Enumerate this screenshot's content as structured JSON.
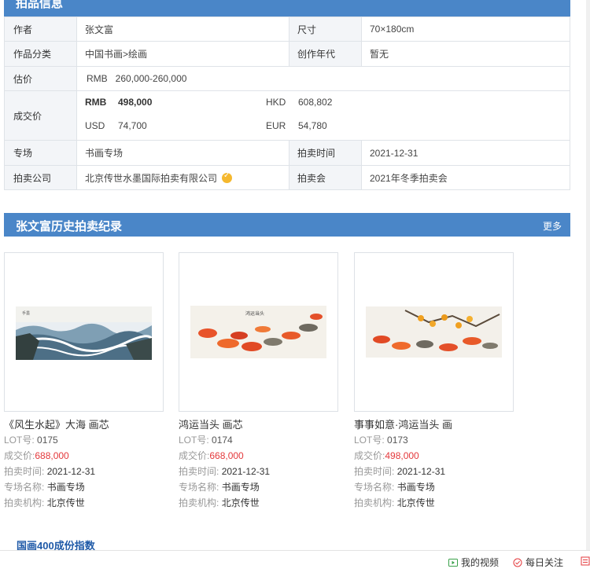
{
  "info_section": {
    "title": "拍品信息"
  },
  "info": {
    "author_label": "作者",
    "author": "张文富",
    "size_label": "尺寸",
    "size": "70×180cm",
    "category_label": "作品分类",
    "category": "中国书画>绘画",
    "era_label": "创作年代",
    "era": "暂无",
    "estimate_label": "估价",
    "estimate": "RMB   260,000-260,000",
    "deal_label": "成交价",
    "deal": {
      "rmb_cur": "RMB",
      "rmb": "498,000",
      "hkd_cur": "HKD",
      "hkd": "608,802",
      "usd_cur": "USD",
      "usd": "74,700",
      "eur_cur": "EUR",
      "eur": "54,780"
    },
    "session_label": "专场",
    "session": "书画专场",
    "time_label": "拍卖时间",
    "time": "2021-12-31",
    "company_label": "拍卖公司",
    "company": "北京传世水墨国际拍卖有限公司",
    "auction_label": "拍卖会",
    "auction": "2021年冬季拍卖会"
  },
  "history_section": {
    "title": "张文富历史拍卖纪录",
    "more": "更多"
  },
  "lots": [
    {
      "name": "《风生水起》大海 画芯",
      "lot_label": "LOT号:",
      "lot": "0175",
      "price_label": "成交价:",
      "price": "688,000",
      "time_label": "拍卖时间:",
      "time": "2021-12-31",
      "session_label": "专场名称:",
      "session": "书画专场",
      "org_label": "拍卖机构:",
      "org": "北京传世"
    },
    {
      "name": "鸿运当头 画芯",
      "lot_label": "LOT号:",
      "lot": "0174",
      "price_label": "成交价:",
      "price": "668,000",
      "time_label": "拍卖时间:",
      "time": "2021-12-31",
      "session_label": "专场名称:",
      "session": "书画专场",
      "org_label": "拍卖机构:",
      "org": "北京传世"
    },
    {
      "name": "事事如意·鸿运当头 画",
      "lot_label": "LOT号:",
      "lot": "0173",
      "price_label": "成交价:",
      "price": "498,000",
      "time_label": "拍卖时间:",
      "time": "2021-12-31",
      "session_label": "专场名称:",
      "session": "书画专场",
      "org_label": "拍卖机构:",
      "org": "北京传世"
    }
  ],
  "index_link": "国画400成份指数",
  "bottom_bar": {
    "video": "我的视频",
    "follow": "每日关注"
  },
  "colors": {
    "header_blue": "#4a86c8",
    "price_red": "#e4393c",
    "link_blue": "#1f5aa8"
  }
}
